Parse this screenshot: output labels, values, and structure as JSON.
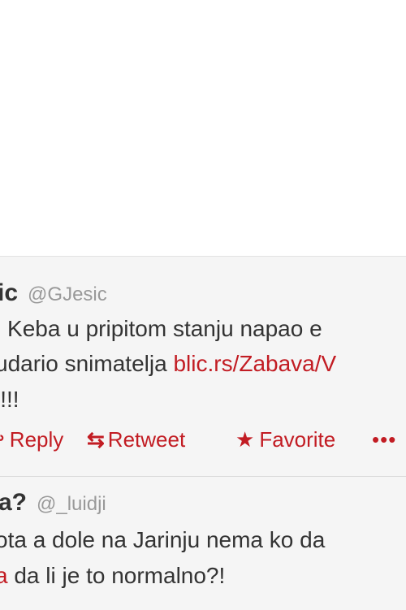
{
  "tweets": [
    {
      "name": "ic",
      "handle": "@GJesic",
      "lines": [
        "| Keba u pripitom stanju napao e",
        "udario snimatelja ",
        "!!!"
      ],
      "link": "blic.rs/Zabava/V",
      "line3_prefix_red": "",
      "actions": {
        "reply_label": "Reply",
        "retweet_label": "Retweet",
        "favorite_label": "Favorite",
        "more_label": "•••"
      }
    },
    {
      "name": "ta?",
      "handle": "@_luidji",
      "lines": [
        "ota a dole na Jarinju nema ko da",
        " da li je to normalno?!"
      ],
      "mention_fragment": "a"
    }
  ],
  "icons": {
    "reply": "reply-arrow-icon",
    "retweet": "retweet-icon",
    "favorite": "star-icon",
    "more": "more-dots-icon"
  },
  "colors": {
    "accent": "#c21c23",
    "tweet_bg": "#f5f5f5",
    "handle": "#999999"
  }
}
